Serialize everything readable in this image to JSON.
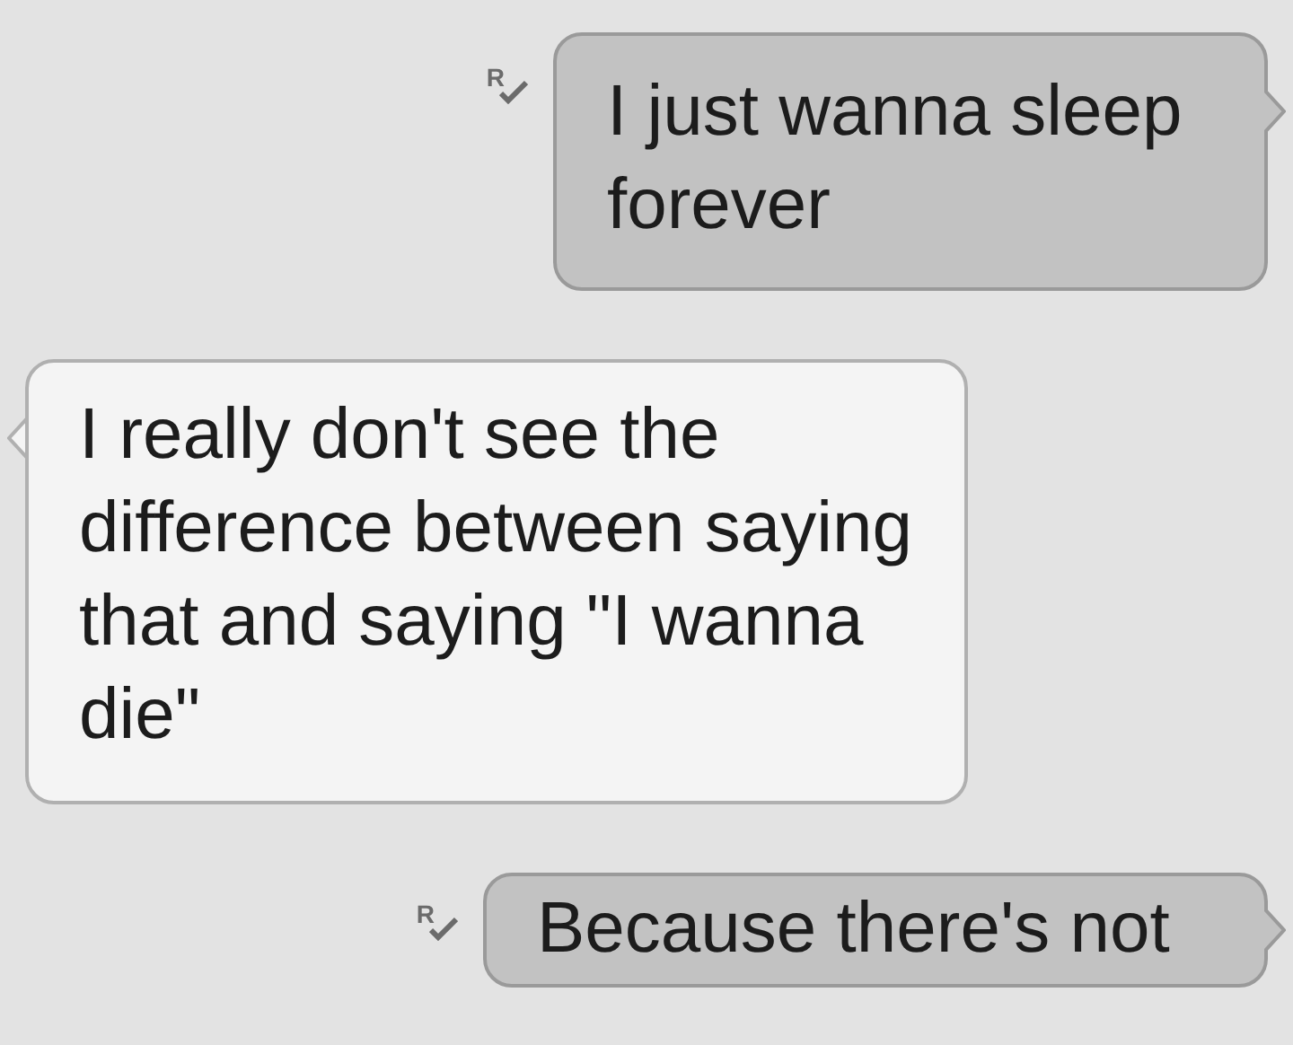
{
  "messages": [
    {
      "kind": "sent",
      "text": "I just wanna sleep forever",
      "status": "R"
    },
    {
      "kind": "received",
      "text": "I really don't see the difference between saying that and saying \"I wanna die\""
    },
    {
      "kind": "sent",
      "text": "Because there's not",
      "status": "R"
    }
  ]
}
